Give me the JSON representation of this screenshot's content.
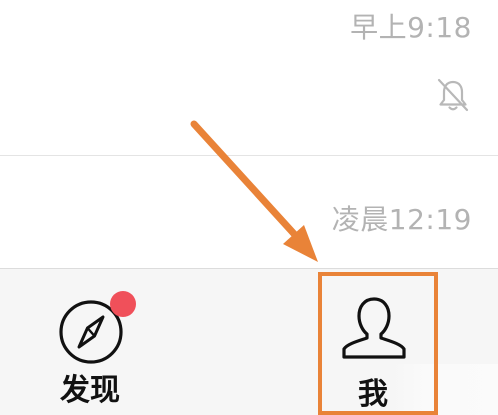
{
  "messages": [
    {
      "time": "早上9:18",
      "muted": true
    },
    {
      "time": "凌晨12:19",
      "muted": false
    }
  ],
  "tabbar": {
    "discover": {
      "label": "发现",
      "icon": "compass-icon",
      "has_badge": true
    },
    "me": {
      "label": "我",
      "icon": "person-icon"
    }
  },
  "annotation": {
    "arrow_color": "#e98338",
    "highlight_color": "#e98338",
    "badge_color": "#f0505a"
  }
}
